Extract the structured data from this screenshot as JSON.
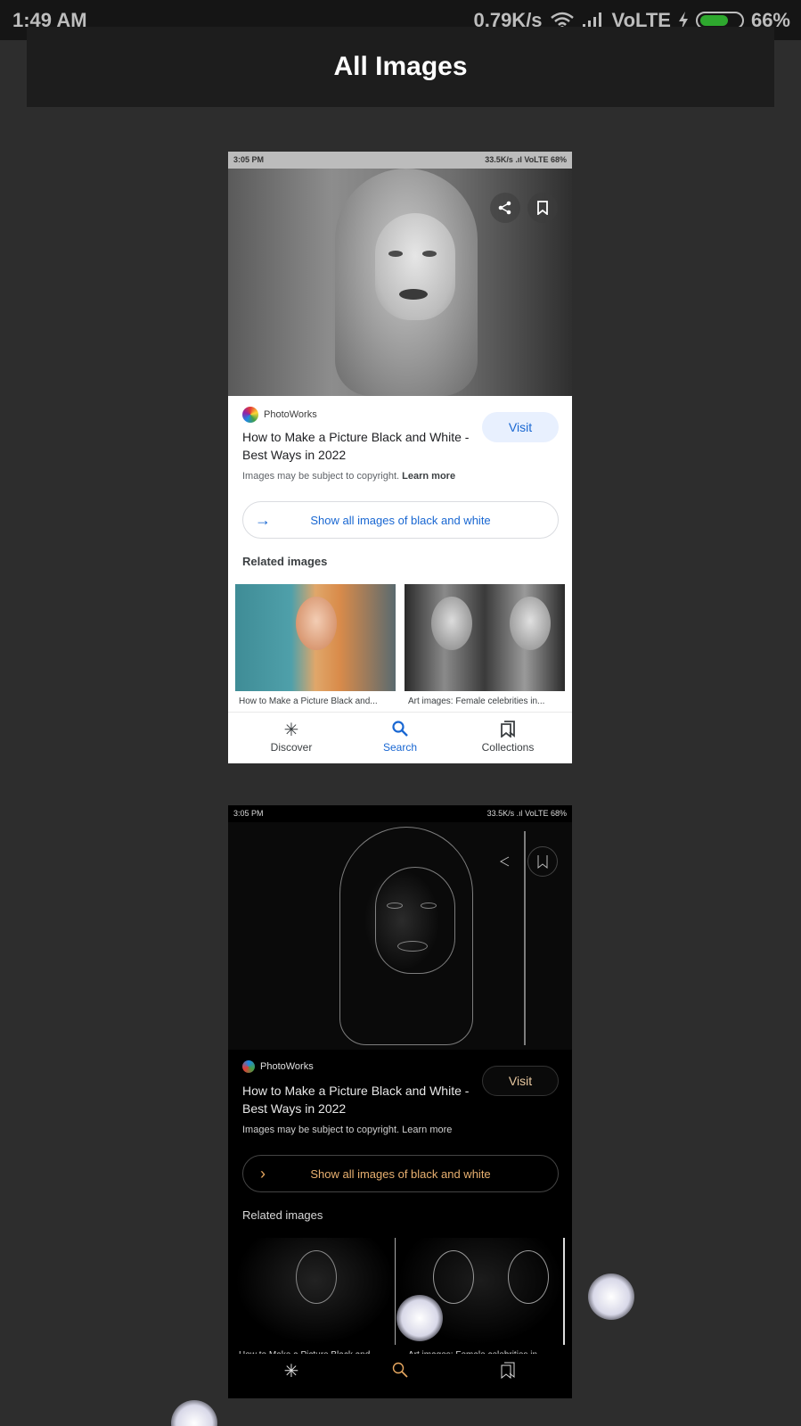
{
  "statusbar": {
    "time": "1:49 AM",
    "speed": "0.79K/s",
    "network": "VoLTE",
    "battery": "66%",
    "icons": [
      "wifi-icon",
      "signal-icon",
      "charging-icon",
      "battery-icon"
    ]
  },
  "header": {
    "title": "All Images"
  },
  "screenshots": [
    {
      "mini_status": {
        "time": "3:05 PM",
        "info": "33.5K/s  .ıl VoLTE  68%"
      },
      "source": "PhotoWorks",
      "title": "How to Make a Picture Black and White - Best Ways in 2022",
      "visit": "Visit",
      "copyright": "Images may be subject to copyright.",
      "learn_more": "Learn more",
      "show_all": "Show all images of black and white",
      "related": "Related images",
      "captions": [
        "How to Make a Picture Black and...",
        "Art images: Female celebrities in..."
      ],
      "nav": [
        "Discover",
        "Search",
        "Collections"
      ]
    },
    {
      "mini_status": {
        "time": "3:05 PM",
        "info": "33.5K/s  .ıl VoLTE  68%"
      },
      "source": "PhotoWorks",
      "title": "How to Make a Picture Black and White - Best Ways in 2022",
      "visit": "Visit",
      "copyright": "Images may be subject to copyright.",
      "learn_more": "Learn more",
      "show_all": "Show all images of black and white",
      "related": "Related images",
      "captions": [
        "How to Make a Picture Black and...",
        "Art images: Female celebrities in..."
      ]
    }
  ],
  "colors": {
    "background": "#2d2d2d",
    "accent_blue": "#1967d2",
    "accent_orange": "#e8a860"
  }
}
